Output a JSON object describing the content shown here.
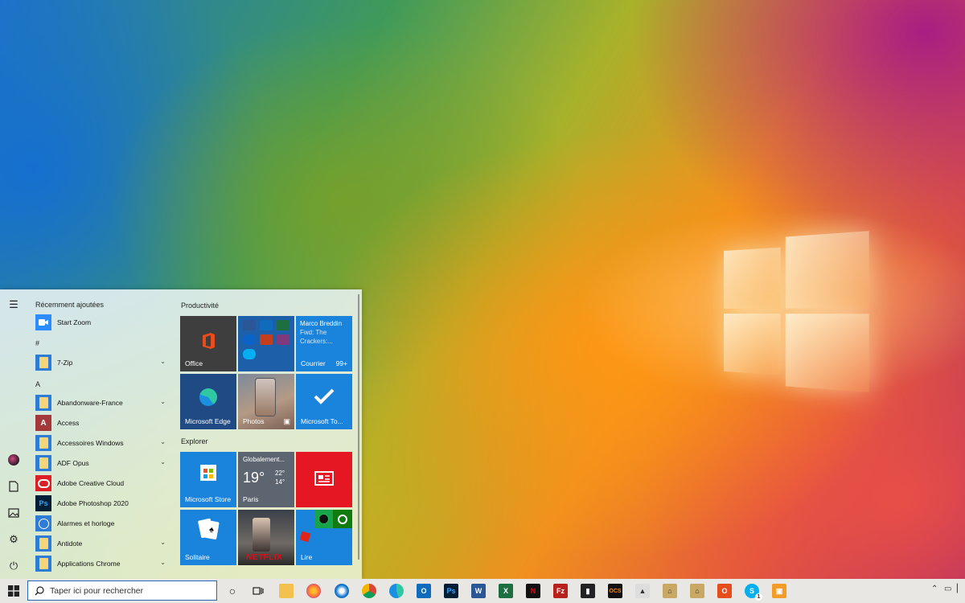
{
  "start_menu": {
    "recent_header": "Récemment ajoutées",
    "recent_app": "Start Zoom",
    "letter_hash": "#",
    "letter_a": "A",
    "apps": [
      "7-Zip",
      "Abandonware-France",
      "Access",
      "Accessoires Windows",
      "ADF Opus",
      "Adobe Creative Cloud",
      "Adobe Photoshop 2020",
      "Alarmes et horloge",
      "Antidote",
      "Applications Chrome"
    ],
    "group_productivity": "Productivité",
    "group_explore": "Explorer",
    "tiles": {
      "office": "Office",
      "mail_sender": "Marco Breddin",
      "mail_subject": "Fwd: The Crackers:...",
      "mail_label": "Courrier",
      "mail_count": "99+",
      "edge": "Microsoft Edge",
      "photos": "Photos",
      "todo": "Microsoft To...",
      "store": "Microsoft Store",
      "weather_title": "Globalement...",
      "weather_temp": "19°",
      "weather_high": "22°",
      "weather_low": "14°",
      "weather_city": "Paris",
      "solitaire": "Solitaire",
      "netflix": "NETFLIX",
      "read": "Lire"
    }
  },
  "taskbar": {
    "search_placeholder": "Taper ici pour rechercher",
    "skype_badge": "1",
    "apps": [
      "file-explorer",
      "firefox",
      "thunderbird",
      "chrome",
      "edge",
      "outlook",
      "photoshop",
      "word",
      "excel",
      "netflix",
      "filezilla",
      "app-dark",
      "ocs",
      "app-mountain",
      "app-house-1",
      "app-house-2",
      "office",
      "skype",
      "app-orange"
    ]
  },
  "colors": {
    "accent": "#2b77d4",
    "office_tile": "#3e3e3e",
    "mail_tile": "#1a83dc",
    "edge_tile": "#1f4a83",
    "read_red": "#e51722"
  }
}
